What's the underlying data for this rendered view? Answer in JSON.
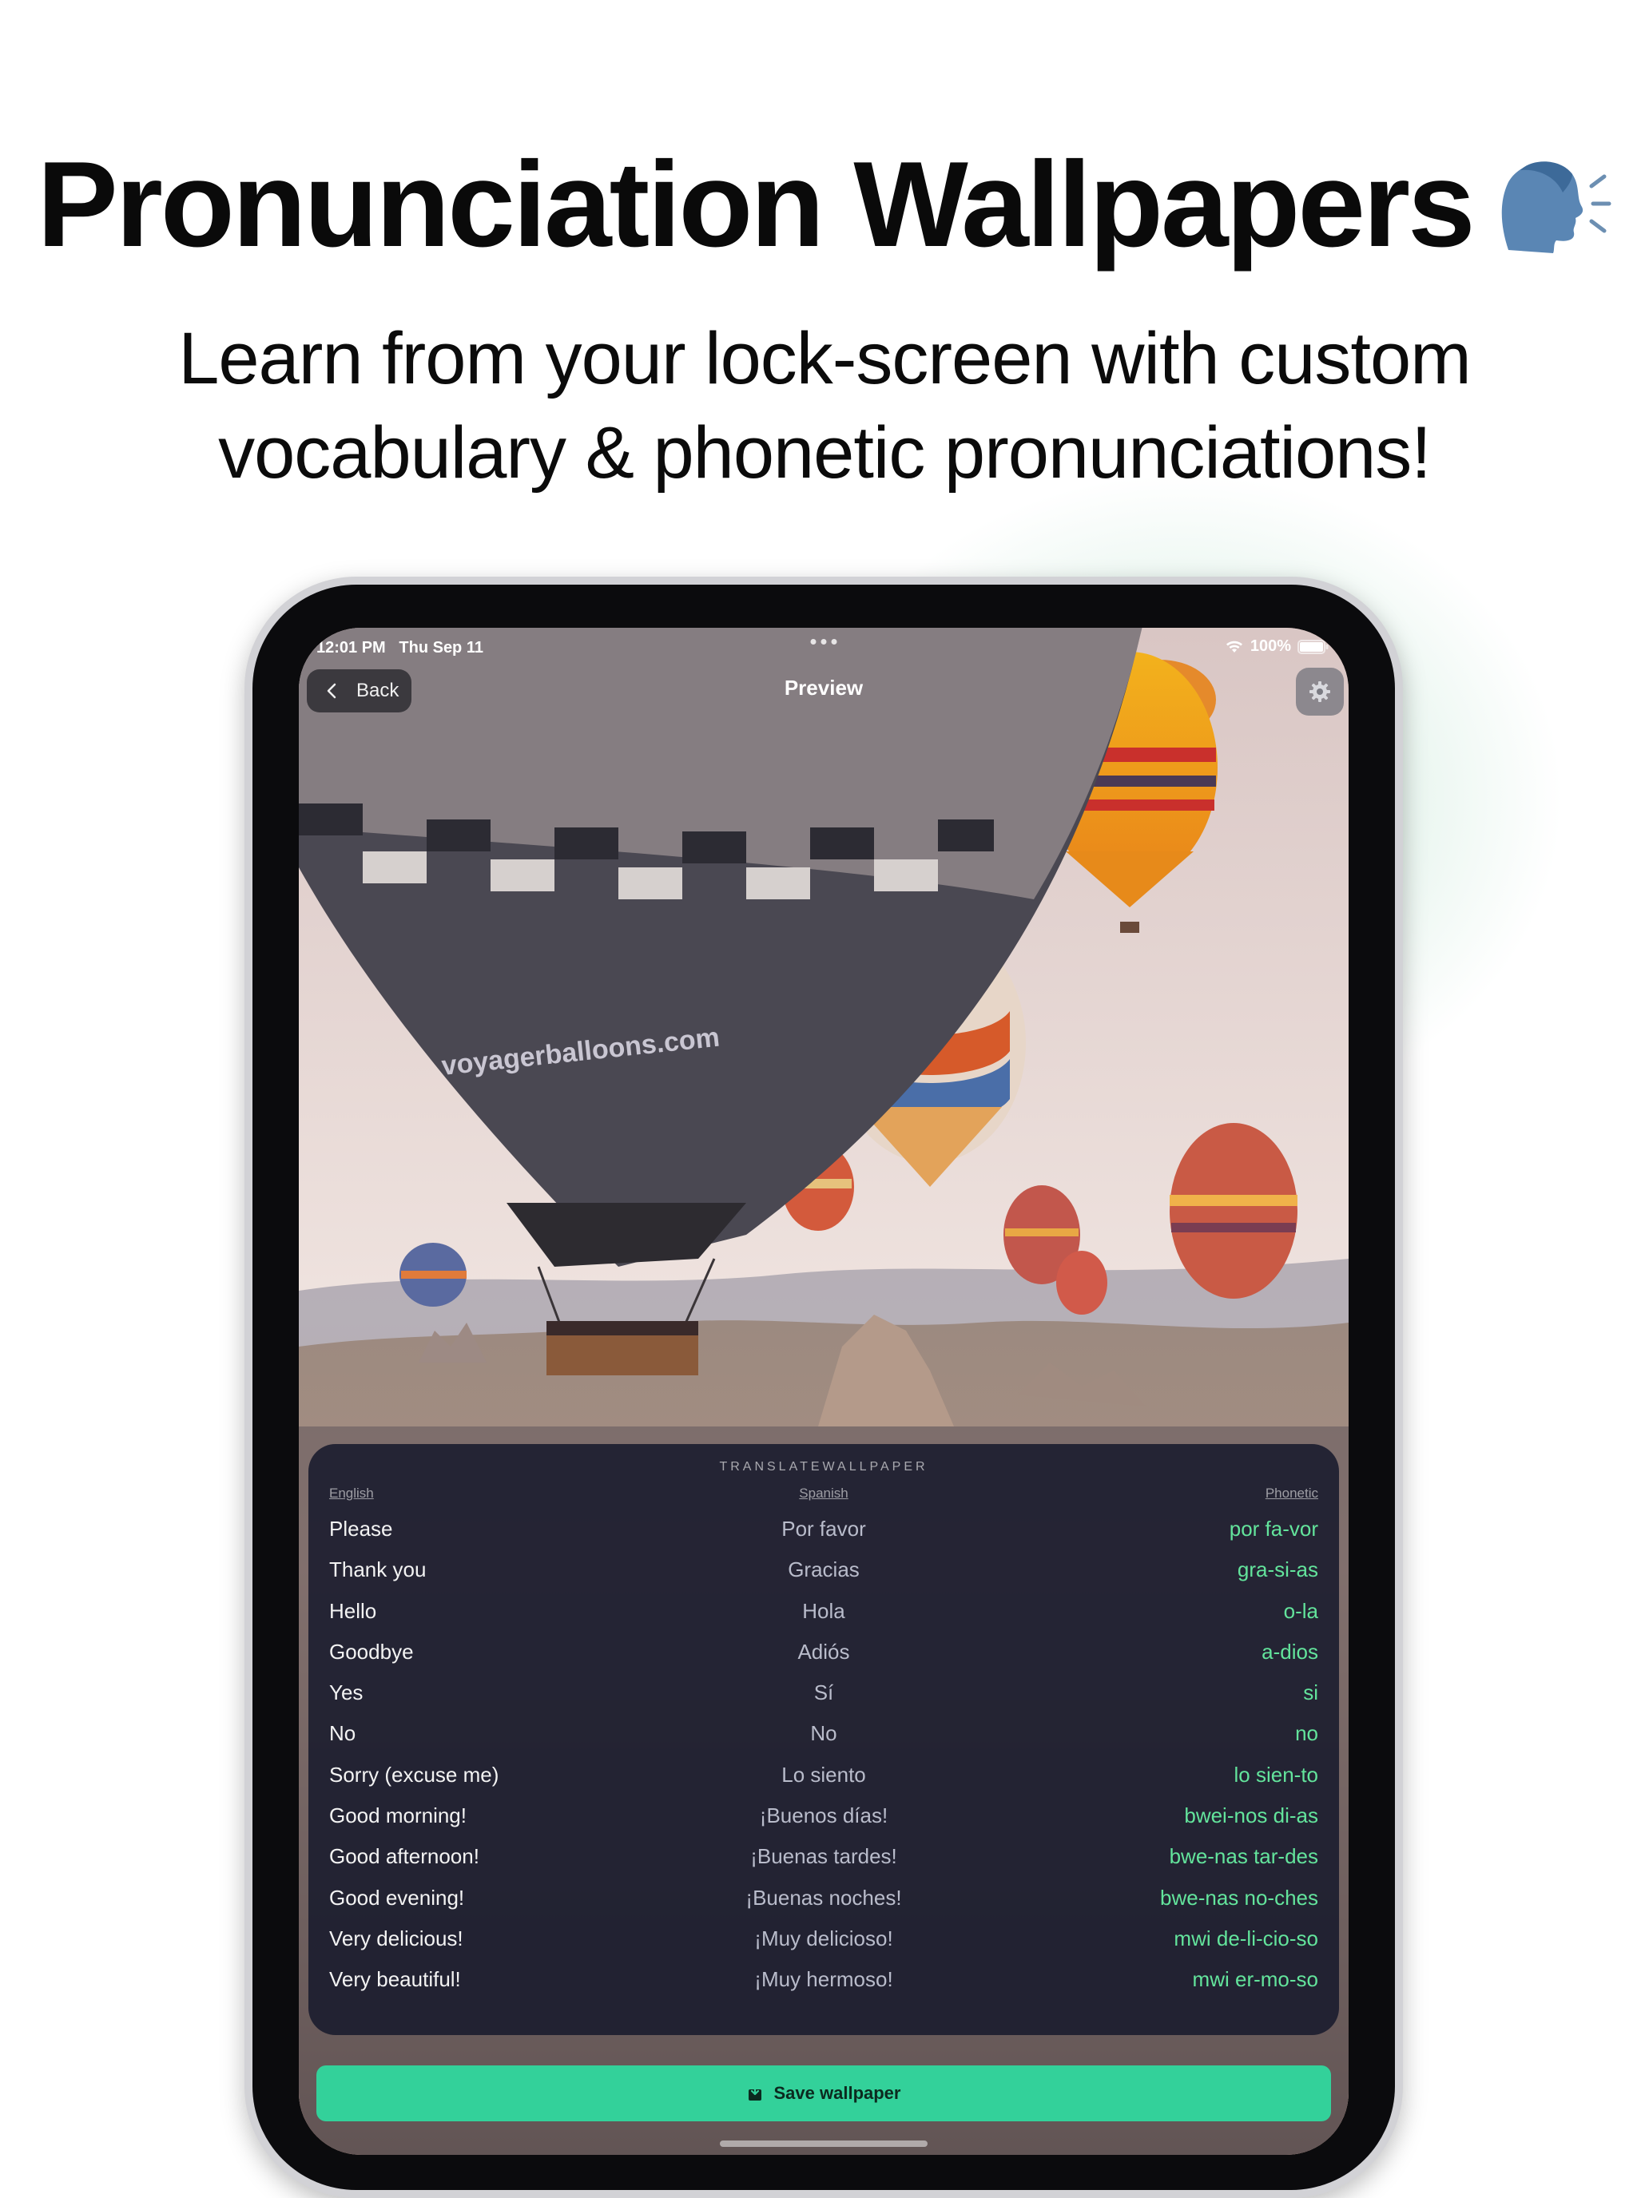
{
  "header": {
    "title": "Pronunciation Wallpapers",
    "title_icon": "speaking-head-icon",
    "subtitle_line1": "Learn from your lock-screen with custom",
    "subtitle_line2": "vocabulary & phonetic pronunciations!"
  },
  "status_bar": {
    "time": "12:01 PM",
    "date": "Thu Sep 11",
    "battery": "100%"
  },
  "nav": {
    "back_label": "Back",
    "title": "Preview",
    "settings_icon": "gear-icon"
  },
  "wallpaper_card": {
    "brand": "TRANSLATEWALLPAPER",
    "columns": {
      "english": "English",
      "spanish": "Spanish",
      "phonetic": "Phonetic"
    },
    "rows": [
      {
        "en": "Please",
        "es": "Por favor",
        "ph": "por fa-vor"
      },
      {
        "en": "Thank you",
        "es": "Gracias",
        "ph": "gra-si-as"
      },
      {
        "en": "Hello",
        "es": "Hola",
        "ph": "o-la"
      },
      {
        "en": "Goodbye",
        "es": "Adiós",
        "ph": "a-dios"
      },
      {
        "en": "Yes",
        "es": "Sí",
        "ph": "si"
      },
      {
        "en": "No",
        "es": "No",
        "ph": "no"
      },
      {
        "en": "Sorry (excuse me)",
        "es": "Lo siento",
        "ph": "lo sien-to"
      },
      {
        "en": "Good morning!",
        "es": "¡Buenos días!",
        "ph": "bwei-nos di-as"
      },
      {
        "en": "Good afternoon!",
        "es": "¡Buenas tardes!",
        "ph": "bwe-nas tar-des"
      },
      {
        "en": "Good evening!",
        "es": "¡Buenas noches!",
        "ph": "bwe-nas no-ches"
      },
      {
        "en": "Very delicious!",
        "es": "¡Muy delicioso!",
        "ph": "mwi de-li-cio-so"
      },
      {
        "en": "Very beautiful!",
        "es": "¡Muy hermoso!",
        "ph": "mwi er-mo-so"
      }
    ]
  },
  "save_button": {
    "label": "Save wallpaper",
    "icon": "save-icon"
  },
  "colors": {
    "accent": "#33d19a",
    "phonetic_text": "#63e49c",
    "card_bg": "#181a2c"
  }
}
